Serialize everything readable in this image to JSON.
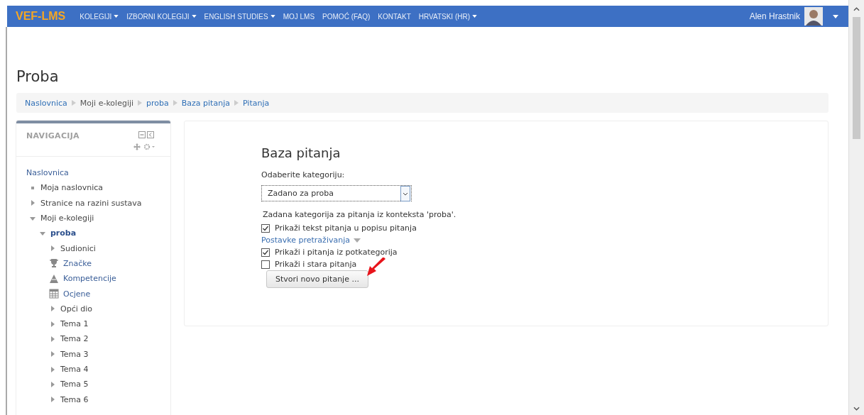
{
  "navbar": {
    "brand": "VEF-LMS",
    "menu": [
      {
        "label": "KOLEGIJI",
        "dropdown": true
      },
      {
        "label": "IZBORNI KOLEGIJI",
        "dropdown": true
      },
      {
        "label": "ENGLISH STUDIES",
        "dropdown": true
      },
      {
        "label": "MOJ LMS",
        "dropdown": false
      },
      {
        "label": "POMOĆ (FAQ)",
        "dropdown": false
      },
      {
        "label": "KONTAKT",
        "dropdown": false
      },
      {
        "label": "HRVATSKI (HR)",
        "dropdown": true
      }
    ],
    "user": "Alen Hrastnik"
  },
  "page_title": "Proba",
  "breadcrumb": [
    "Naslovnica",
    "Moji e-kolegiji",
    "proba",
    "Baza pitanja",
    "Pitanja"
  ],
  "navigation": {
    "title": "NAVIGACIJA",
    "items": [
      {
        "label": "Naslovnica",
        "kind": "plain",
        "children": [
          {
            "label": "Moja naslovnica",
            "kind": "bullet"
          },
          {
            "label": "Stranice na razini sustava",
            "kind": "branch",
            "expanded": false
          },
          {
            "label": "Moji e-kolegiji",
            "kind": "branch",
            "expanded": true,
            "children": [
              {
                "label": "proba",
                "kind": "branch",
                "expanded": true,
                "current": true,
                "children": [
                  {
                    "label": "Sudionici",
                    "kind": "branch",
                    "expanded": false
                  },
                  {
                    "label": "Značke",
                    "kind": "trophy"
                  },
                  {
                    "label": "Kompetencije",
                    "kind": "competency"
                  },
                  {
                    "label": "Ocjene",
                    "kind": "grades"
                  },
                  {
                    "label": "Opći dio",
                    "kind": "branch",
                    "expanded": false
                  },
                  {
                    "label": "Tema 1",
                    "kind": "branch",
                    "expanded": false
                  },
                  {
                    "label": "Tema 2",
                    "kind": "branch",
                    "expanded": false
                  },
                  {
                    "label": "Tema 3",
                    "kind": "branch",
                    "expanded": false
                  },
                  {
                    "label": "Tema 4",
                    "kind": "branch",
                    "expanded": false
                  },
                  {
                    "label": "Tema 5",
                    "kind": "branch",
                    "expanded": false
                  },
                  {
                    "label": "Tema 6",
                    "kind": "branch",
                    "expanded": false
                  }
                ]
              }
            ]
          }
        ]
      }
    ]
  },
  "main": {
    "heading": "Baza pitanja",
    "category_label": "Odaberite kategoriju:",
    "category_value": "Zadano za proba",
    "category_info": "Zadana kategorija za pitanja iz konteksta 'proba'.",
    "options": [
      {
        "label": "Prikaži tekst pitanja u popisu pitanja",
        "checked": true
      }
    ],
    "search_settings": "Postavke pretraživanja",
    "search_options": [
      {
        "label": "Prikaži i pitanja iz potkategorija",
        "checked": true
      },
      {
        "label": "Prikaži i stara pitanja",
        "checked": false
      }
    ],
    "create_button": "Stvori novo pitanje ..."
  }
}
